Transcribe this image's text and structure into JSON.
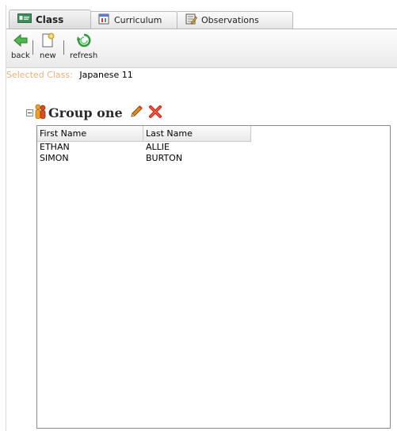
{
  "tabs": [
    {
      "label": "Class",
      "icon": "id-card-icon",
      "selected": true
    },
    {
      "label": "Curriculum",
      "icon": "calendar-icon",
      "selected": false
    },
    {
      "label": "Observations",
      "icon": "notepad-pencil-icon",
      "selected": false
    }
  ],
  "toolbar": {
    "back_label": "back",
    "new_label": "new",
    "refresh_label": "refresh"
  },
  "selected_class": {
    "label": "Selected Class:",
    "value": "Japanese 11"
  },
  "group": {
    "title": "Group one",
    "columns": [
      "First Name",
      "Last Name"
    ],
    "rows": [
      {
        "first": "ETHAN",
        "last": "ALLIE"
      },
      {
        "first": "SIMON",
        "last": "BURTON"
      }
    ]
  },
  "colors": {
    "accent_orange": "#e8b37a",
    "delete_red": "#d9261c",
    "edit_orange": "#e08a1e",
    "back_green": "#3aa63a"
  }
}
